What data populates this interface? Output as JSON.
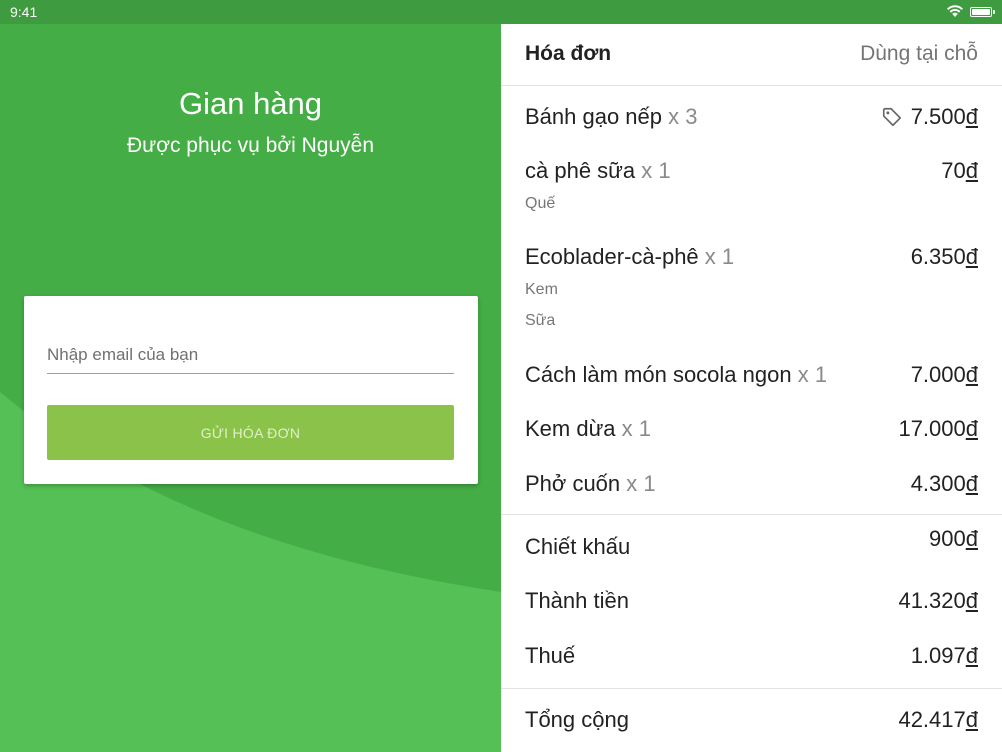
{
  "status_bar": {
    "time": "9:41"
  },
  "store": {
    "title": "Gian hàng",
    "subtitle": "Được phục vụ bởi Nguyễn"
  },
  "email_form": {
    "placeholder": "Nhập email của bạn",
    "send_label": "GỬI HÓA ĐƠN"
  },
  "invoice": {
    "title": "Hóa đơn",
    "dine_option": "Dùng tại chỗ",
    "currency": "đ",
    "items": [
      {
        "name": "Bánh gạo nếp",
        "qty": "x 3",
        "price": "7.500",
        "discount_tag": true,
        "options": []
      },
      {
        "name": "cà phê sữa",
        "qty": "x 1",
        "price": "70",
        "options": [
          "Quế"
        ]
      },
      {
        "name": "Ecoblader-cà-phê",
        "qty": "x 1",
        "price": "6.350",
        "options": [
          "Kem",
          "Sữa"
        ]
      },
      {
        "name": "Cách làm món socola ngon",
        "qty": "x 1",
        "price": "7.000",
        "options": []
      },
      {
        "name": "Kem dừa",
        "qty": "x 1",
        "price": "17.000",
        "options": []
      },
      {
        "name": "Phở cuốn",
        "qty": "x 1",
        "price": "4.300",
        "options": []
      }
    ],
    "summary": [
      {
        "label": "Chiết khấu",
        "value": "900"
      },
      {
        "label": "Thành tiền",
        "value": "41.320"
      },
      {
        "label": "Thuế",
        "value": "1.097"
      }
    ],
    "total": {
      "label": "Tổng cộng",
      "value": "42.417"
    }
  },
  "colors": {
    "status_bar": "#3f9b3f",
    "left_background": "#45ad45",
    "left_curve": "#55c055",
    "button": "#8bc34a"
  },
  "icons": {
    "wifi": "wifi-icon",
    "battery": "battery-icon",
    "discount_tag": "tag-icon"
  }
}
